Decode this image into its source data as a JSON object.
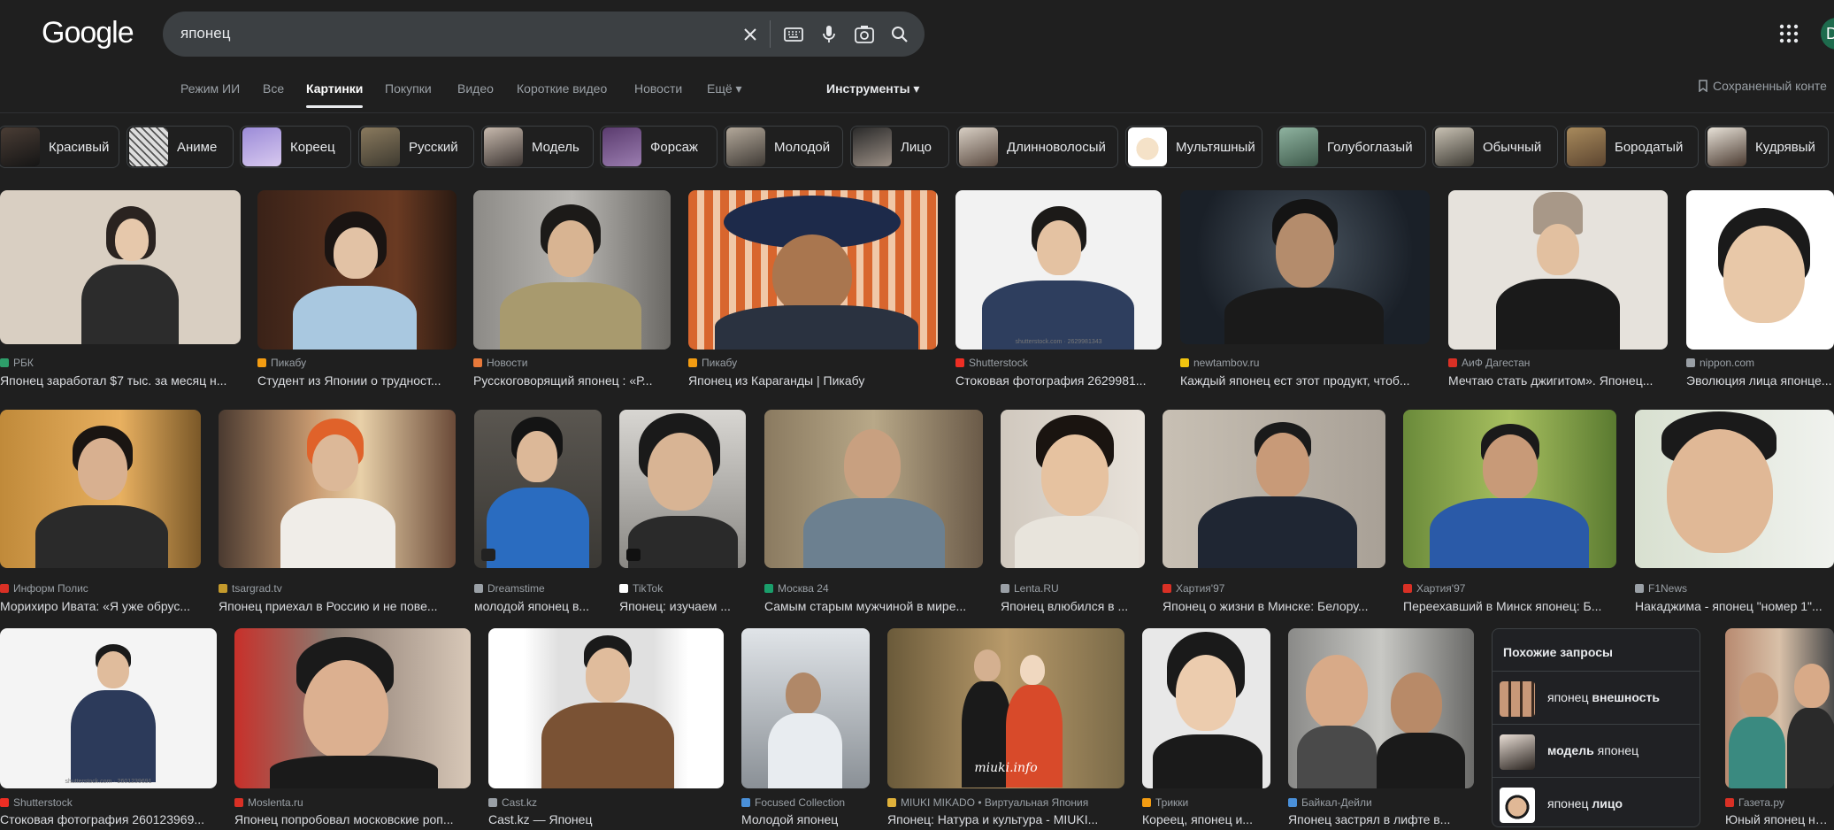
{
  "header": {
    "logo": "Google",
    "search_value": "японец",
    "avatar_letter": "D"
  },
  "tabs": {
    "items": [
      "Режим ИИ",
      "Все",
      "Картинки",
      "Покупки",
      "Видео",
      "Короткие видео",
      "Новости",
      "Ещё ▾"
    ],
    "active": "Картинки",
    "tools": "Инструменты ▾",
    "saved": "Сохраненный конте"
  },
  "chips": [
    "Красивый",
    "Аниме",
    "Кореец",
    "Русский",
    "Модель",
    "Форсаж",
    "Молодой",
    "Лицо",
    "Длинноволосый",
    "Мультяшный",
    "Голубоглазый",
    "Обычный",
    "Бородатый",
    "Кудрявый"
  ],
  "results": {
    "row1": [
      {
        "source": "РБК",
        "title": "Японец заработал $7 тыс. за месяц н...",
        "favicon": "#2e9e6a"
      },
      {
        "source": "Пикабу",
        "title": "Студент из Японии о трудност...",
        "favicon": "#f39c12"
      },
      {
        "source": "Новости",
        "title": "Русскоговорящий японец : «Р...",
        "favicon": "#e8793a"
      },
      {
        "source": "Пикабу",
        "title": "Японец из Караганды | Пикабу",
        "favicon": "#f39c12"
      },
      {
        "source": "Shutterstock",
        "title": "Стоковая фотография 2629981...",
        "favicon": "#ee2e24"
      },
      {
        "source": "newtambov.ru",
        "title": "Каждый японец ест этот продукт, чтоб...",
        "favicon": "#f1c40f"
      },
      {
        "source": "АиФ Дагестан",
        "title": "Мечтаю стать джигитом». Японец...",
        "favicon": "#d93025"
      },
      {
        "source": "nippon.com",
        "title": "Эволюция лица японце...",
        "favicon": "#9aa0a6"
      }
    ],
    "row2": [
      {
        "source": "Информ Полис",
        "title": "Морихиро Ивата: «Я уже обрус...",
        "favicon": "#d93025"
      },
      {
        "source": "tsargrad.tv",
        "title": "Японец приехал в Россию и не пове...",
        "favicon": "#c49a2c"
      },
      {
        "source": "Dreamstime",
        "title": "молодой японец в...",
        "favicon": "#9aa0a6"
      },
      {
        "source": "TikTok",
        "title": "Японец: изучаем ...",
        "favicon": "#ffffff"
      },
      {
        "source": "Москва 24",
        "title": "Самым старым мужчиной в мире...",
        "favicon": "#1a9e6b"
      },
      {
        "source": "Lenta.RU",
        "title": "Японец влюбился в ...",
        "favicon": "#9aa0a6"
      },
      {
        "source": "Хартия'97",
        "title": "Японец о жизни в Минске: Белору...",
        "favicon": "#d93025"
      },
      {
        "source": "Хартия'97",
        "title": "Переехавший в Минск японец: Б...",
        "favicon": "#d93025"
      },
      {
        "source": "F1News",
        "title": "Накаджима - японец \"номер 1\"...",
        "favicon": "#9aa0a6"
      }
    ],
    "row3": [
      {
        "source": "Shutterstock",
        "title": "Стоковая фотография 260123969...",
        "favicon": "#ee2e24"
      },
      {
        "source": "Moslenta.ru",
        "title": "Японец попробовал московские роп...",
        "favicon": "#d93025"
      },
      {
        "source": "Cast.kz",
        "title": "Cast.kz — Японец",
        "favicon": "#9aa0a6"
      },
      {
        "source": "Focused Collection",
        "title": "Молодой японец",
        "favicon": "#4a90d9"
      },
      {
        "source": "MIUKI MIKADO • Виртуальная Япония",
        "title": "Японец: Натура и культура - MIUKI...",
        "favicon": "#e0b13a"
      },
      {
        "source": "Трикки",
        "title": "Кореец, японец и...",
        "favicon": "#f39c12"
      },
      {
        "source": "Байкал-Дейли",
        "title": "Японец застрял в лифте в...",
        "favicon": "#4a90d9"
      },
      {
        "source": "Газета.ру",
        "title": "Юный японец нач...",
        "favicon": "#d93025"
      }
    ],
    "watermarks": [
      "shutterstock.com · 2629981343",
      "shutterstock.com · 2601239691",
      "miuki.info"
    ]
  },
  "related": {
    "title": "Похожие запросы",
    "items": [
      {
        "prefix": "японец ",
        "bold": "внешность",
        "suffix": ""
      },
      {
        "prefix": "",
        "bold": "модель",
        "suffix": " японец"
      },
      {
        "prefix": "японец ",
        "bold": "лицо",
        "suffix": ""
      }
    ]
  }
}
